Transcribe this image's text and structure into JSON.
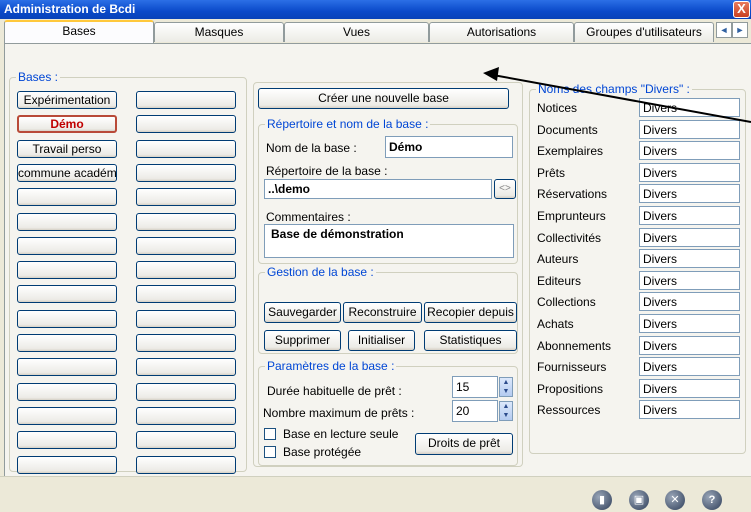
{
  "window": {
    "title": "Administration de Bcdi",
    "close_label": "X"
  },
  "tabs": [
    {
      "label": "Bases"
    },
    {
      "label": "Masques"
    },
    {
      "label": "Vues"
    },
    {
      "label": "Autorisations"
    },
    {
      "label": "Groupes d'utilisateurs"
    }
  ],
  "tab_scroll": {
    "left": "◄",
    "right": "►"
  },
  "bases": {
    "legend": "Bases :",
    "left_buttons": [
      "Expérimentation",
      "Démo",
      "Travail perso",
      "commune académ",
      "",
      "",
      "",
      "",
      "",
      "",
      "",
      "",
      "",
      "",
      "",
      ""
    ],
    "right_buttons": [
      "",
      "",
      "",
      "",
      "",
      "",
      "",
      "",
      "",
      "",
      "",
      "",
      "",
      "",
      "",
      ""
    ]
  },
  "create_button": "Créer une nouvelle base",
  "repertoire": {
    "legend": "Répertoire et nom de la base :",
    "nom_label": "Nom de la base :",
    "nom_value": "Démo",
    "rep_label": "Répertoire de la base :",
    "rep_value": "..\\demo",
    "browse": "<>",
    "comment_label": "Commentaires :",
    "comment_value": "Base de démonstration"
  },
  "gestion": {
    "legend": "Gestion de la base :",
    "sauvegarder": "Sauvegarder",
    "reconstruire": "Reconstruire",
    "recopier": "Recopier depuis",
    "supprimer": "Supprimer",
    "initialiser": "Initialiser",
    "statistiques": "Statistiques"
  },
  "parametres": {
    "legend": "Paramètres de la base :",
    "duree_label": "Durée habituelle de prêt :",
    "duree_value": "15",
    "nombre_label": "Nombre maximum de prêts :",
    "nombre_value": "20",
    "lecture_seule": "Base en lecture seule",
    "protegee": "Base protégée",
    "droits": "Droits de prêt"
  },
  "champs": {
    "legend": "Noms des champs \"Divers\" :",
    "rows": [
      {
        "label": "Notices",
        "value": "Divers"
      },
      {
        "label": "Documents",
        "value": "Divers"
      },
      {
        "label": "Exemplaires",
        "value": "Divers"
      },
      {
        "label": "Prêts",
        "value": "Divers"
      },
      {
        "label": "Réservations",
        "value": "Divers"
      },
      {
        "label": "Emprunteurs",
        "value": "Divers"
      },
      {
        "label": "Collectivités",
        "value": "Divers"
      },
      {
        "label": "Auteurs",
        "value": "Divers"
      },
      {
        "label": "Editeurs",
        "value": "Divers"
      },
      {
        "label": "Collections",
        "value": "Divers"
      },
      {
        "label": "Achats",
        "value": "Divers"
      },
      {
        "label": "Abonnements",
        "value": "Divers"
      },
      {
        "label": "Fournisseurs",
        "value": "Divers"
      },
      {
        "label": "Propositions",
        "value": "Divers"
      },
      {
        "label": "Ressources",
        "value": "Divers"
      }
    ]
  },
  "statusbar": {
    "icons": [
      {
        "name": "book-icon",
        "glyph": "▮"
      },
      {
        "name": "save-icon",
        "glyph": "▣"
      },
      {
        "name": "close-circle-icon",
        "glyph": "✕"
      },
      {
        "name": "help-icon",
        "glyph": "?"
      }
    ]
  }
}
